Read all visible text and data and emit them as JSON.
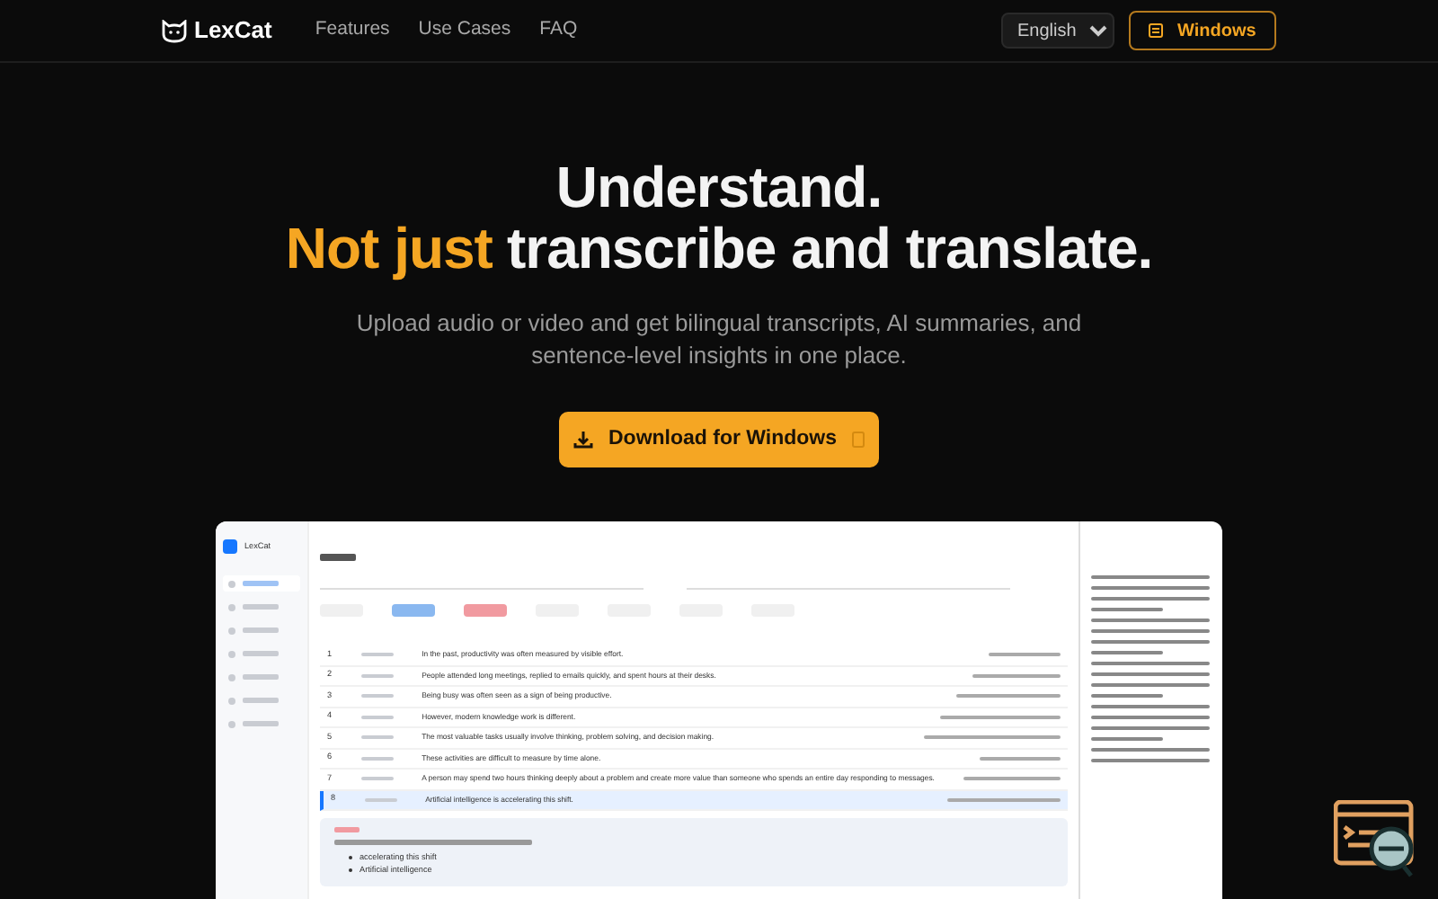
{
  "nav": {
    "brand": "LexCat",
    "links": [
      "Features",
      "Use Cases",
      "FAQ"
    ],
    "language": "English",
    "platform_button": "Windows"
  },
  "hero": {
    "title_line_1": "Understand.",
    "title_highlight": "Not just",
    "title_rest": "transcribe and translate.",
    "subtitle": "Upload audio or video and get bilingual transcripts, AI summaries, and sentence-level insights in one place.",
    "download_button": "Download for Windows"
  },
  "app_preview": {
    "brand": "LexCat",
    "sidebar_items": [
      {
        "selected": true
      },
      {
        "selected": false
      },
      {
        "selected": false
      },
      {
        "selected": false
      },
      {
        "selected": false
      },
      {
        "selected": false
      },
      {
        "selected": false
      }
    ],
    "rows": [
      {
        "number": "1",
        "text": "In the past, productivity was often measured by visible effort.",
        "selected": false
      },
      {
        "number": "2",
        "text": "People attended long meetings, replied to emails quickly, and spent hours at their desks.",
        "selected": false
      },
      {
        "number": "3",
        "text": "Being busy was often seen as a sign of being productive.",
        "selected": false
      },
      {
        "number": "4",
        "text": "However, modern knowledge work is different.",
        "selected": false
      },
      {
        "number": "5",
        "text": "The most valuable tasks usually involve thinking, problem solving, and decision making.",
        "selected": false
      },
      {
        "number": "6",
        "text": "These activities are difficult to measure by time alone.",
        "selected": false
      },
      {
        "number": "7",
        "text": "A person may spend two hours thinking deeply about a problem and create more value than someone who spends an entire day responding to messages.",
        "selected": false
      },
      {
        "number": "8",
        "text": "Artificial intelligence is accelerating this shift.",
        "selected": true
      }
    ],
    "note_terms": [
      "accelerating this shift",
      "Artificial intelligence"
    ]
  }
}
